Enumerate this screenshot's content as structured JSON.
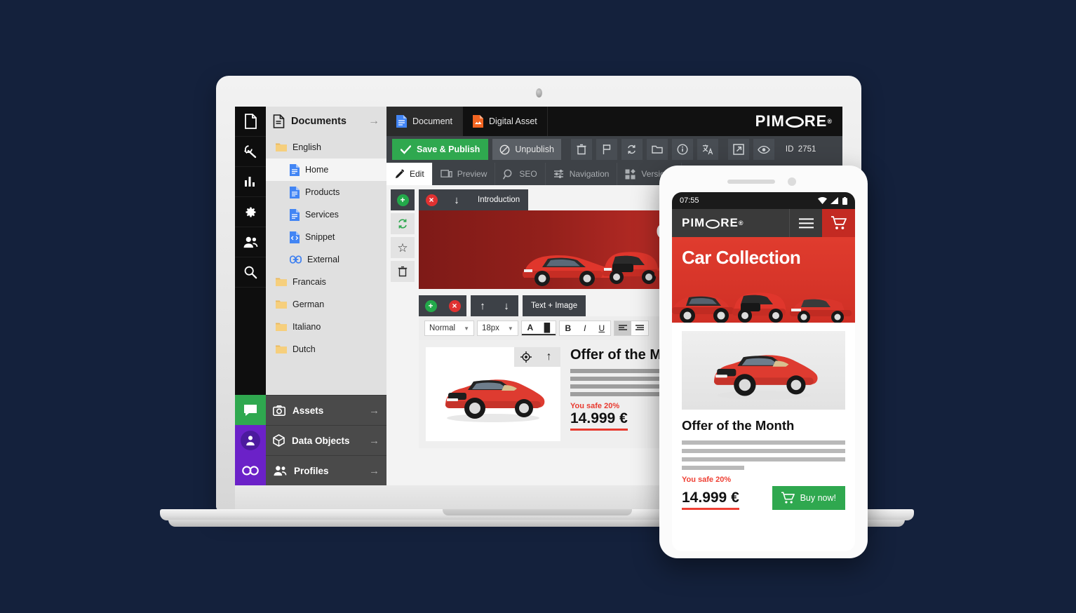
{
  "background_color": "#14213c",
  "brand": {
    "name": "PIMCORE",
    "trademark": "®"
  },
  "rail": {
    "top_items": [
      {
        "name": "document-icon",
        "label": "Documents"
      },
      {
        "name": "wrench-icon",
        "label": "Tools"
      },
      {
        "name": "chart-icon",
        "label": "Reports"
      },
      {
        "name": "gear-icon",
        "label": "Settings"
      },
      {
        "name": "users-icon",
        "label": "Users"
      },
      {
        "name": "search-icon",
        "label": "Search"
      }
    ],
    "bottom_items": [
      {
        "name": "chat-icon",
        "label": "Notifications",
        "color": "#2fa84f"
      },
      {
        "name": "user-avatar-icon",
        "label": "Profile",
        "color": "#6b21c8"
      },
      {
        "name": "infinity-icon",
        "label": "Pimcore Loop",
        "color": "#6b21c8"
      }
    ]
  },
  "tree": {
    "title": "Documents",
    "collapse_arrow": "→",
    "nodes": [
      {
        "label": "English",
        "icon": "folder-icon",
        "type": "folder",
        "level": 0,
        "selected": false
      },
      {
        "label": "Home",
        "icon": "page-icon",
        "type": "page",
        "level": 1,
        "selected": true
      },
      {
        "label": "Products",
        "icon": "page-icon",
        "type": "page",
        "level": 1,
        "selected": false
      },
      {
        "label": "Services",
        "icon": "page-icon",
        "type": "page",
        "level": 1,
        "selected": false
      },
      {
        "label": "Snippet",
        "icon": "snippet-icon",
        "type": "snippet",
        "level": 1,
        "selected": false
      },
      {
        "label": "External",
        "icon": "link-icon",
        "type": "link",
        "level": 1,
        "selected": false
      },
      {
        "label": "Francais",
        "icon": "folder-icon",
        "type": "folder",
        "level": 0,
        "selected": false
      },
      {
        "label": "German",
        "icon": "folder-icon",
        "type": "folder",
        "level": 0,
        "selected": false
      },
      {
        "label": "Italiano",
        "icon": "folder-icon",
        "type": "folder",
        "level": 0,
        "selected": false
      },
      {
        "label": "Dutch",
        "icon": "folder-icon",
        "type": "folder",
        "level": 0,
        "selected": false
      }
    ],
    "sections": [
      {
        "label": "Assets",
        "icon": "camera-icon",
        "arrow": "→"
      },
      {
        "label": "Data Objects",
        "icon": "cube-icon",
        "arrow": "→"
      },
      {
        "label": "Profiles",
        "icon": "people-icon",
        "arrow": "→"
      }
    ]
  },
  "top_tabs": [
    {
      "label": "Document",
      "icon": "document-tab-icon",
      "active": true
    },
    {
      "label": "Digital Asset",
      "icon": "image-tab-icon",
      "active": false
    }
  ],
  "action_bar": {
    "save_label": "Save & Publish",
    "unpublish_label": "Unpublish",
    "icons": [
      {
        "name": "trash-icon"
      },
      {
        "name": "flag-icon"
      },
      {
        "name": "refresh-icon"
      },
      {
        "name": "folder-icon"
      },
      {
        "name": "info-icon"
      },
      {
        "name": "translate-icon"
      },
      {
        "name": "open-external-icon"
      },
      {
        "name": "eye-icon"
      }
    ],
    "id_label": "ID",
    "id_value": "2751"
  },
  "sub_tabs": [
    {
      "label": "Edit",
      "icon": "pencil-icon",
      "active": true
    },
    {
      "label": "Preview",
      "icon": "devices-icon",
      "active": false
    },
    {
      "label": "SEO",
      "icon": "seo-search-icon",
      "active": false
    },
    {
      "label": "Navigation",
      "icon": "sliders-icon",
      "active": false
    },
    {
      "label": "Versions",
      "icon": "blocks-icon",
      "active": false
    }
  ],
  "editor": {
    "block_intro": {
      "label": "Introduction",
      "add_icon": "plus-circle-icon",
      "remove_icon": "close-circle-icon",
      "move_down_icon": "arrow-down-icon",
      "side_tools": [
        {
          "name": "reload-icon",
          "glyph": "↻"
        },
        {
          "name": "star-icon",
          "glyph": "☆"
        },
        {
          "name": "trash-icon",
          "glyph": "Ὕ1"
        }
      ]
    },
    "hero_title": "Car Collection",
    "block_text_image": {
      "label": "Text + Image",
      "add_icon": "plus-circle-icon",
      "remove_icon": "close-circle-icon",
      "move_up_icon": "arrow-up-icon",
      "move_down_icon": "arrow-down-icon"
    },
    "rte": {
      "format_value": "Normal",
      "size_value": "18px",
      "text_color_icon": "font-color-icon",
      "highlight_icon": "highlight-color-icon",
      "bold": "B",
      "italic": "I",
      "underline": "U",
      "align_left_icon": "align-left-icon",
      "align_center_icon": "align-center-icon"
    },
    "image_overlay": {
      "target_icon": "crop-target-icon",
      "upload_icon": "arrow-up-icon"
    },
    "offer": {
      "heading": "Offer of the Month",
      "save_text": "You safe 20%",
      "price": "14.999 €"
    }
  },
  "phone": {
    "status": {
      "time": "07:55",
      "wifi_icon": "wifi-icon",
      "signal_icon": "signal-icon",
      "battery_icon": "battery-icon"
    },
    "nav": {
      "logo": "PIMCORE",
      "menu_icon": "hamburger-icon",
      "cart_icon": "cart-icon"
    },
    "hero_title": "Car Collection",
    "offer": {
      "heading": "Offer of the Month",
      "save_text": "You safe 20%",
      "price": "14.999 €",
      "buy_label": "Buy now!",
      "buy_icon": "cart-icon"
    }
  },
  "colors": {
    "accent_green": "#2fa84f",
    "accent_red": "#e8392e",
    "accent_purple": "#6b21c8",
    "dark_navy": "#14213c"
  }
}
